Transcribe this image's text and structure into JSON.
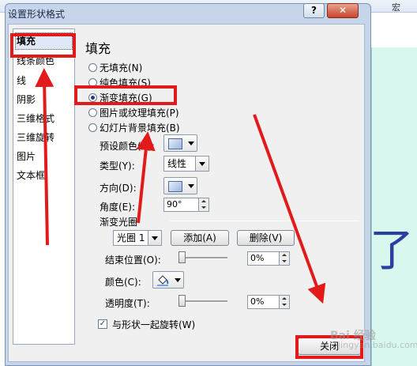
{
  "background_app": {
    "ribbon_label": "宏"
  },
  "dialog": {
    "title": "设置形状格式",
    "help_label": "?",
    "close_x_label": "✕"
  },
  "sidebar": {
    "items": [
      {
        "label": "填充",
        "selected": true
      },
      {
        "label": "线条颜色"
      },
      {
        "label": "线"
      },
      {
        "label": "阴影"
      },
      {
        "label": "三维格式"
      },
      {
        "label": "三维旋转"
      },
      {
        "label": "图片"
      },
      {
        "label": "文本框"
      }
    ]
  },
  "fill": {
    "heading": "填充",
    "options": [
      {
        "label": "无填充(N)",
        "checked": false
      },
      {
        "label": "纯色填充(S)",
        "checked": false
      },
      {
        "label": "渐变填充(G)",
        "checked": true
      },
      {
        "label": "图片或纹理填充(P)",
        "checked": false
      },
      {
        "label": "幻灯片背景填充(B)",
        "checked": false
      }
    ],
    "preset_colors_label": "预设颜色(R):",
    "type_label": "类型(Y):",
    "type_value": "线性",
    "direction_label": "方向(D):",
    "angle_label": "角度(E):",
    "angle_value": "90°",
    "stops_group_label": "渐变光圈",
    "stop_select_value": "光圈 1",
    "add_label": "添加(A)",
    "delete_label": "删除(V)",
    "end_position_label": "结束位置(O):",
    "end_position_value": "0%",
    "color_label": "颜色(C):",
    "transparency_label": "透明度(T):",
    "transparency_value": "0%",
    "rotate_with_shape_label": "与形状一起旋转(W)",
    "rotate_with_shape_checked": true,
    "close_button_label": "关闭"
  },
  "watermark": {
    "line1": "Bai 经验",
    "line2": "jingyan.baidu.com"
  },
  "colors": {
    "annotation_red": "#e21a1a",
    "dialog_frame": "#c6d5ea"
  }
}
